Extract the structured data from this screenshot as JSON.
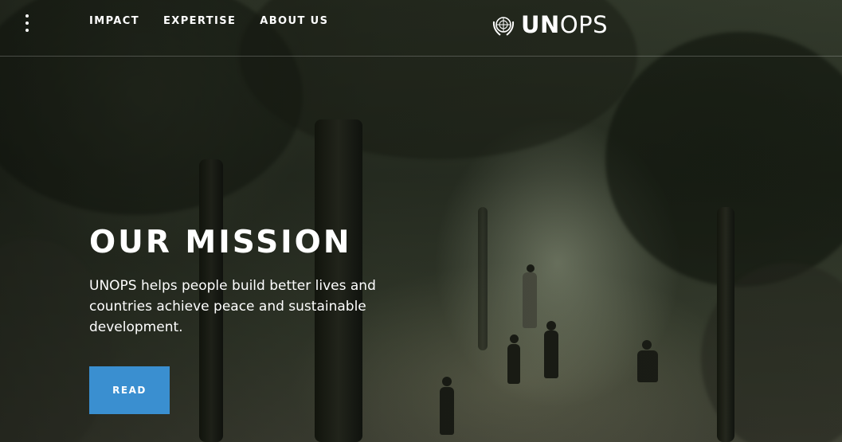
{
  "header": {
    "nav": {
      "impact": "IMPACT",
      "expertise": "EXPERTISE",
      "about": "ABOUT US"
    },
    "logo": {
      "bold": "UN",
      "regular": "OPS"
    }
  },
  "hero": {
    "title": "OUR MISSION",
    "text": "UNOPS helps people build better lives and countries achieve peace and sustainable development.",
    "button": "READ"
  },
  "colors": {
    "button": "#3a8fd0",
    "text": "#ffffff"
  },
  "icons": [
    "menu-dots-icon",
    "un-emblem-icon"
  ]
}
